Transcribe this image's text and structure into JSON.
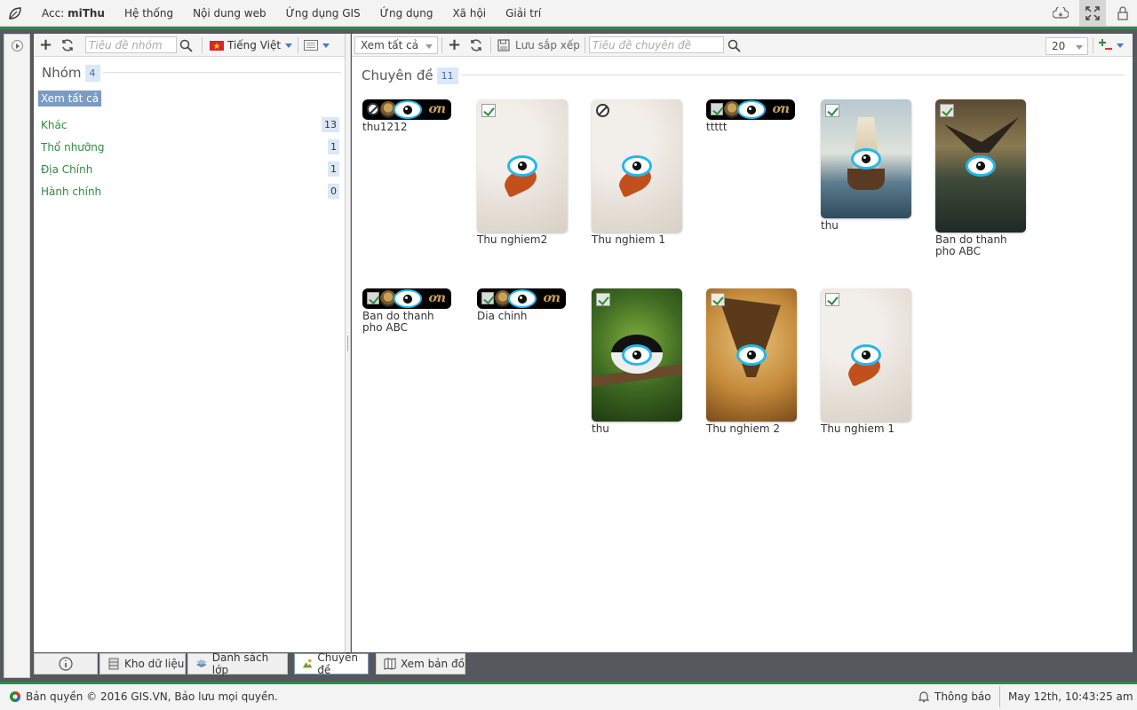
{
  "topbar": {
    "acc_label": "Acc:",
    "acc_user": "miThu",
    "menu": [
      "Hệ thống",
      "Nội dung web",
      "Ứng dụng GIS",
      "Ứng dụng",
      "Xã hội",
      "Giải trí"
    ],
    "icons": [
      "leaf-logo",
      "cloud-sync-icon",
      "fullscreen-icon",
      "lock-icon"
    ]
  },
  "groups": {
    "search_placeholder": "Tiêu đề nhóm",
    "language": "Tiếng Việt",
    "heading": "Nhóm",
    "count": "4",
    "view_all": "Xem tất cả",
    "items": [
      {
        "name": "Khác",
        "count": "13"
      },
      {
        "name": "Thổ nhưỡng",
        "count": "1"
      },
      {
        "name": "Địa Chính",
        "count": "1"
      },
      {
        "name": "Hành chính",
        "count": "0"
      }
    ]
  },
  "topics": {
    "filter": "Xem tất cả",
    "save_order": "Lưu sắp xếp",
    "search_placeholder": "Tiêu đề chuyên đề",
    "page_size": "20",
    "heading": "Chuyên đề",
    "count": "11",
    "cards": [
      {
        "title": "thu1212",
        "kind": "banner",
        "status": "disabled"
      },
      {
        "title": "Thu nghiem2",
        "kind": "snow",
        "status": "checked"
      },
      {
        "title": "Thu nghiem 1",
        "kind": "snow",
        "status": "disabled"
      },
      {
        "title": "ttttt",
        "kind": "banner",
        "status": "checked"
      },
      {
        "title": "thu",
        "kind": "ship",
        "status": "checked"
      },
      {
        "title": "Ban do thanh pho ABC",
        "kind": "eagle",
        "status": "checked"
      },
      {
        "title": "Ban do thanh pho ABC",
        "kind": "banner",
        "status": "checked"
      },
      {
        "title": "Dia chinh",
        "kind": "banner",
        "status": "checked"
      },
      {
        "title": "thu",
        "kind": "panda",
        "status": "checked"
      },
      {
        "title": "Thu nghiem 2",
        "kind": "leaf",
        "status": "checked"
      },
      {
        "title": "Thu nghiem 1",
        "kind": "snow",
        "status": "checked"
      }
    ]
  },
  "tabs": [
    {
      "label": ""
    },
    {
      "label": "Kho dữ liệu"
    },
    {
      "label": "Danh sách lớp"
    },
    {
      "label": "Chuyên đề"
    },
    {
      "label": "Xem bản đồ"
    }
  ],
  "status": {
    "copyright": "Bản quyền © 2016 GIS.VN, Bảo lưu mọi quyền.",
    "notify": "Thông báo",
    "datetime": "May 12th, 10:43:25 am"
  },
  "colors": {
    "accent_green": "#2f8a4a",
    "link_green": "#2e8b3f",
    "badge_blue": "#dbe8f7",
    "eye_blue": "#23b8ee"
  }
}
